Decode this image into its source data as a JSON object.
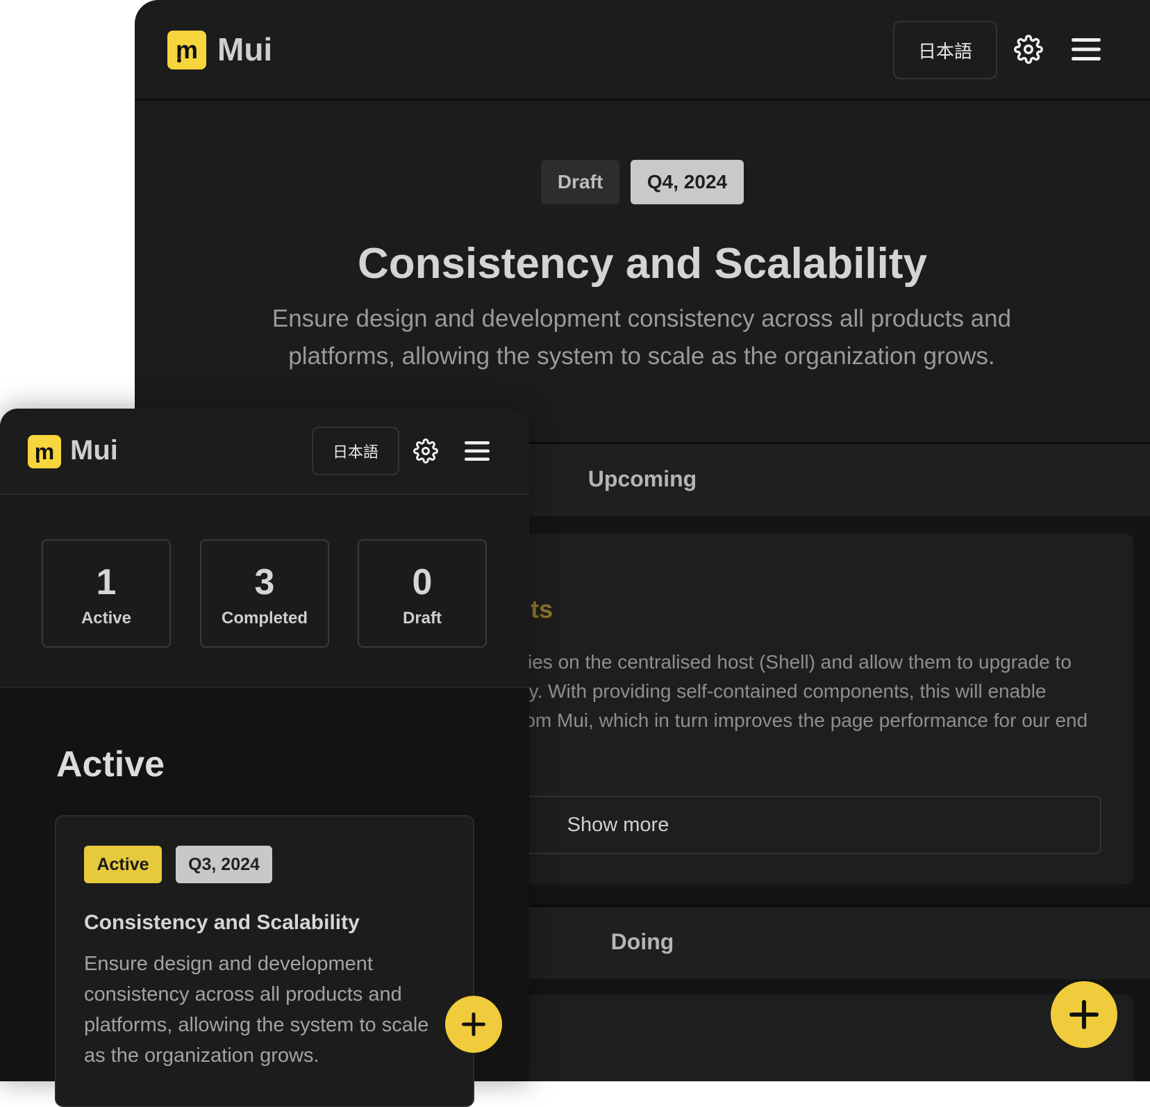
{
  "back_window": {
    "header": {
      "brand": "Mui",
      "logo_letter": "m",
      "language_label": "日本語",
      "settings_icon": "gear-icon",
      "menu_icon": "hamburger-icon"
    },
    "hero": {
      "status_tag": "Draft",
      "quarter_tag": "Q4, 2024",
      "title": "Consistency and Scalability",
      "description_line1": "Ensure design and development consistency across all products and",
      "description_line2": "platforms, allowing the system to scale as the organization grows."
    },
    "sections": {
      "upcoming_label": "Upcoming",
      "doing_label": "Doing"
    },
    "upcoming_card": {
      "title_fragment": "nts",
      "text_line1": "cies on the centralised host (Shell) and allow them to upgrade to",
      "text_line2": "dy. With providing self-contained components, this will enable",
      "text_line3": "rom Mui, which in turn improves the page performance for our end",
      "show_more_label": "Show more"
    },
    "fab_icon": "plus-icon"
  },
  "front_window": {
    "header": {
      "brand": "Mui",
      "logo_letter": "m",
      "language_label": "日本語",
      "settings_icon": "gear-icon",
      "menu_icon": "hamburger-icon"
    },
    "stats": [
      {
        "value": "1",
        "label": "Active"
      },
      {
        "value": "3",
        "label": "Completed"
      },
      {
        "value": "0",
        "label": "Draft"
      }
    ],
    "section_title": "Active",
    "card": {
      "status_tag": "Active",
      "quarter_tag": "Q3, 2024",
      "title": "Consistency and Scalability",
      "description": "Ensure design and development consistency across all products and platforms, allowing the system to scale as the organization grows."
    },
    "fab_icon": "plus-icon"
  },
  "colors": {
    "accent": "#f0cc3c",
    "background_dark": "#1c1c1c"
  }
}
